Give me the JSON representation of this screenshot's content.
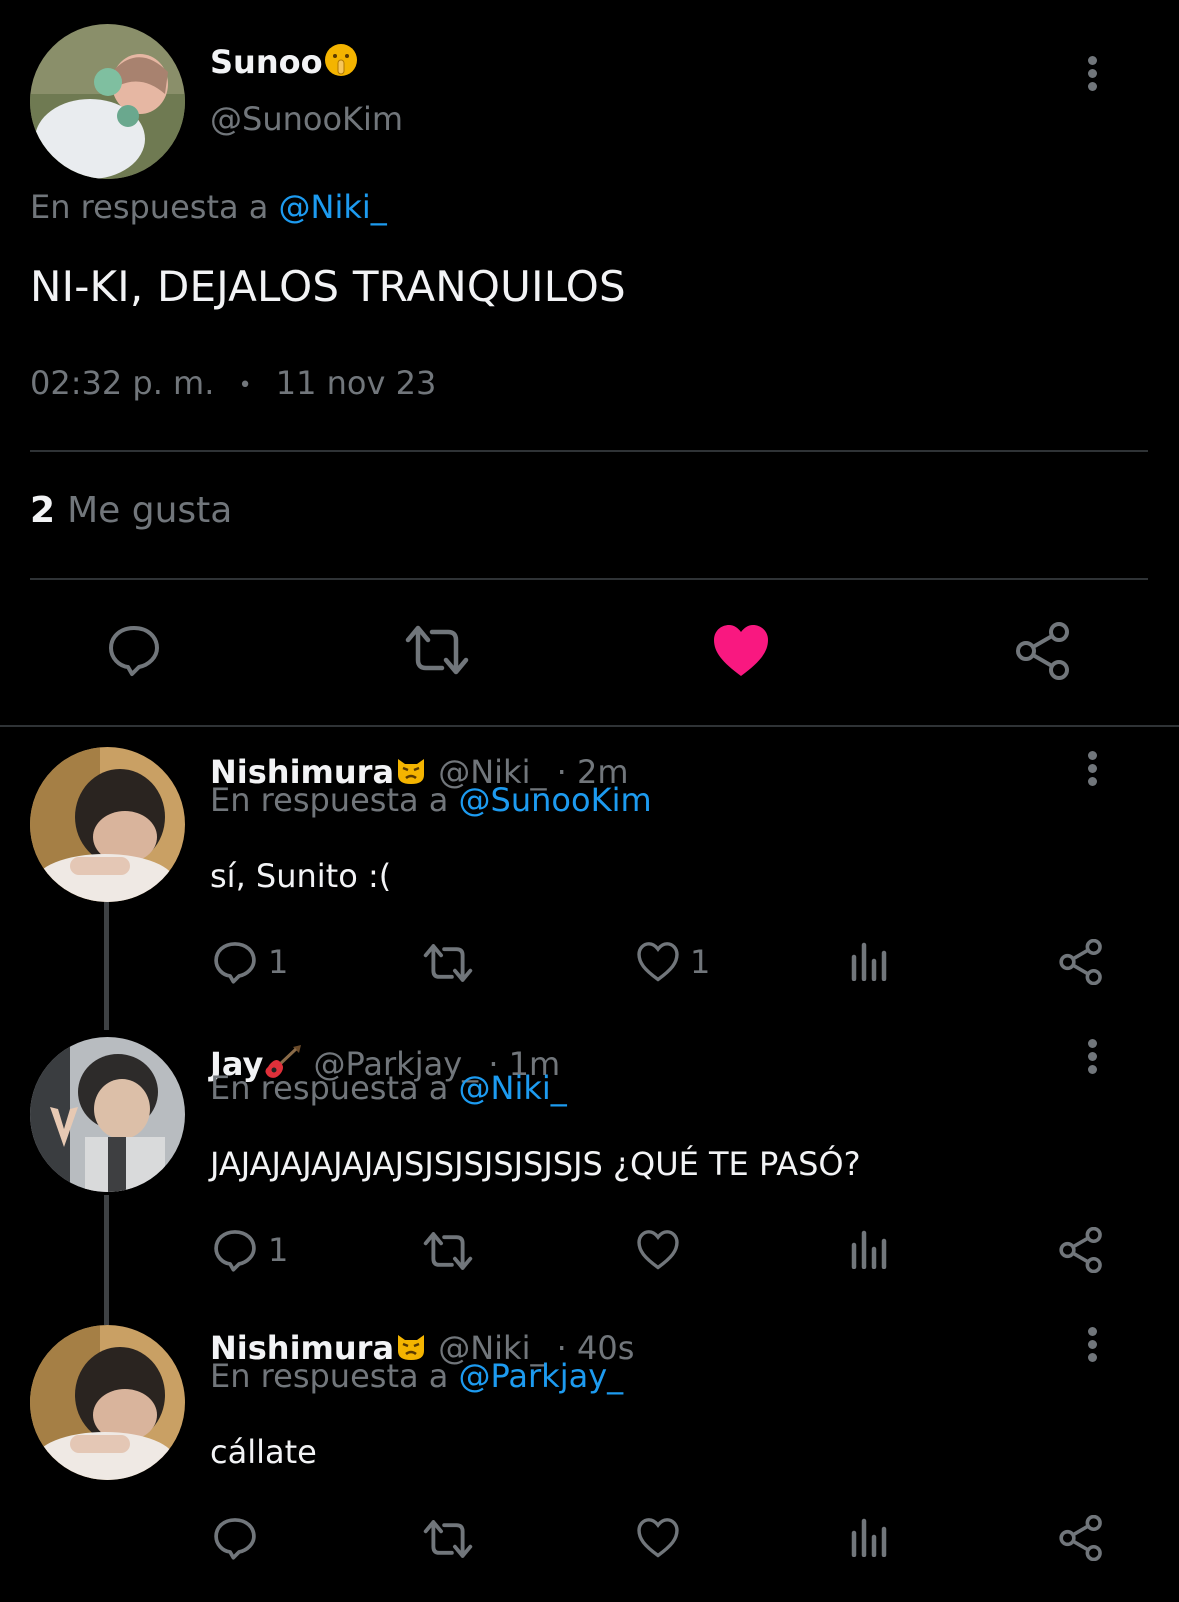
{
  "tweet": {
    "author_name": "Sunoo",
    "author_emoji": "shushing-face-emoji",
    "author_handle": "@SunooKim",
    "reply_prefix": "En respuesta a",
    "reply_mention": "@Niki_",
    "text": "NI-KI, DEJALOS TRANQUILOS",
    "time": "02:32 p. m.",
    "date_sep": "•",
    "date": "11 nov 23",
    "likes_count": "2",
    "likes_label": "Me gusta",
    "liked": true,
    "actions": [
      "reply-icon",
      "retweet-icon",
      "heart-filled-icon",
      "share-icon"
    ]
  },
  "replies": [
    {
      "name": "Nishimura",
      "emoji": "pouting-cat-emoji",
      "handle": "@Niki_ · 2m",
      "reply_prefix": "En respuesta a",
      "reply_mention": "@SunooKim",
      "text": "sí, Sunito :(",
      "reply_count": "1",
      "like_count": "1"
    },
    {
      "name": "Jay",
      "emoji": "guitar-emoji",
      "handle": "@Parkjay_ · 1m",
      "reply_prefix": "En respuesta a",
      "reply_mention": "@Niki_",
      "text": "JAJAJAJAJAJAJSJSJSJSJSJSJS ¿QUÉ TE PASÓ?",
      "reply_count": "1",
      "like_count": ""
    },
    {
      "name": "Nishimura",
      "emoji": "pouting-cat-emoji",
      "handle": "@Niki_ · 40s",
      "reply_prefix": "En respuesta a",
      "reply_mention": "@Parkjay_",
      "text": "cállate",
      "reply_count": "",
      "like_count": ""
    }
  ],
  "colors": {
    "background": "#000000",
    "text": "#e7e9ea",
    "muted": "#71767b",
    "link": "#1d9bf0",
    "like": "#f91880",
    "divider": "#2f3336"
  }
}
